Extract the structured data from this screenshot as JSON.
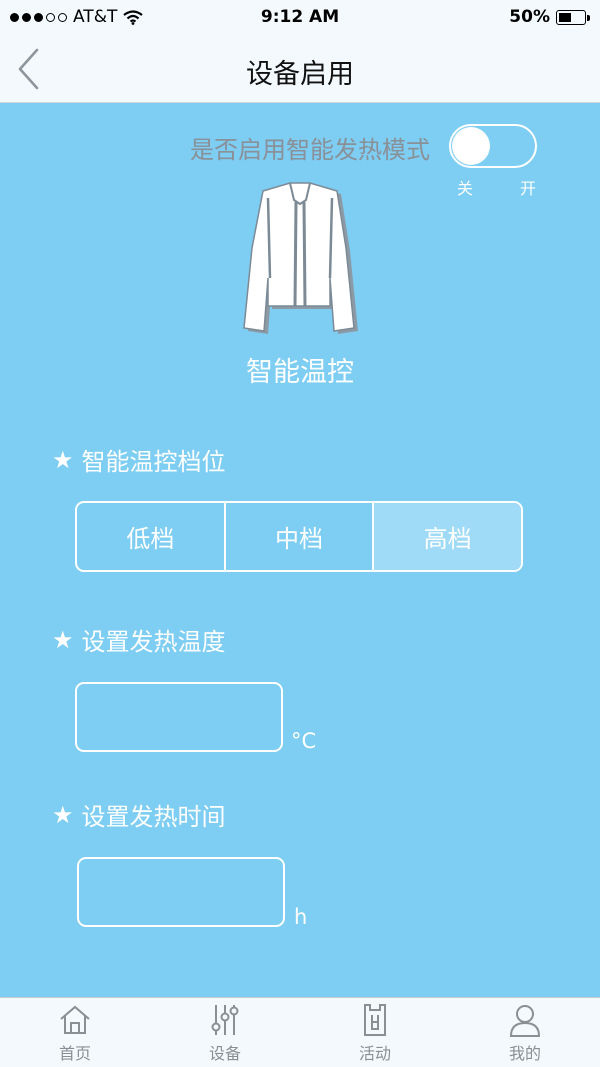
{
  "status_bar": {
    "carrier": "AT&T",
    "time": "9:12 AM",
    "battery_percent": "50%",
    "battery_level": 0.5
  },
  "nav": {
    "back_icon": "chevron-left-icon",
    "title": "设备启用"
  },
  "smart_heat": {
    "label": "是否启用智能发热模式",
    "enabled": false,
    "off_label": "关",
    "on_label": "开"
  },
  "mode": {
    "image_icon": "jacket-icon",
    "title": "智能温控"
  },
  "level_section": {
    "title": "智能温控档位",
    "options": [
      "低档",
      "中档",
      "高档"
    ],
    "selected": "高档"
  },
  "temperature_section": {
    "title": "设置发热温度",
    "value": "",
    "unit": "°C"
  },
  "time_section": {
    "title": "设置发热时间",
    "value": "",
    "unit": "h"
  },
  "tab_bar": {
    "items": [
      {
        "label": "首页",
        "icon": "home-icon"
      },
      {
        "label": "设备",
        "icon": "sliders-icon"
      },
      {
        "label": "活动",
        "icon": "activity-icon"
      },
      {
        "label": "我的",
        "icon": "user-icon"
      }
    ]
  },
  "colors": {
    "background": "#7ecdf3",
    "bar": "#f3f9fc",
    "segment_active": "#9fdaf6",
    "toggle_label": "#8a9097",
    "tab_text": "#8b8f94"
  }
}
